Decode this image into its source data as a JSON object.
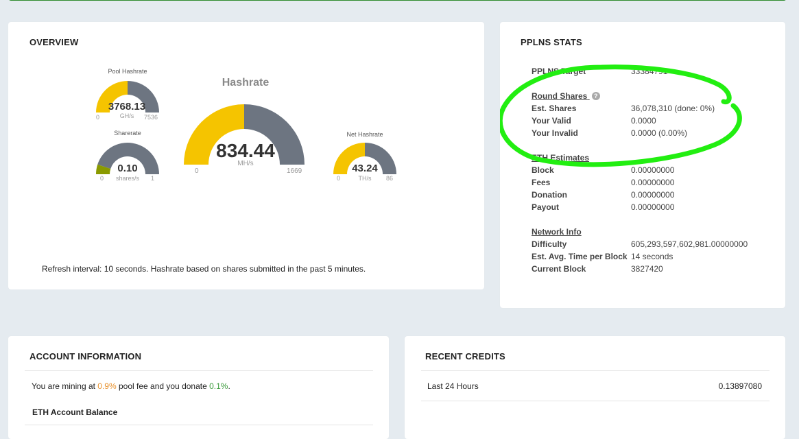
{
  "overview": {
    "title": "OVERVIEW",
    "gauges": {
      "pool": {
        "title": "Pool Hashrate",
        "value": "3768.13",
        "unit": "GH/s",
        "min": "0",
        "max": "7536",
        "fraction": 0.5
      },
      "share": {
        "title": "Sharerate",
        "value": "0.10",
        "unit": "shares/s",
        "min": "0",
        "max": "1",
        "fraction": 0.1
      },
      "main": {
        "title": "Hashrate",
        "value": "834.44",
        "unit": "MH/s",
        "min": "0",
        "max": "1669",
        "fraction": 0.5
      },
      "net": {
        "title": "Net Hashrate",
        "value": "43.24",
        "unit": "TH/s",
        "min": "0",
        "max": "86",
        "fraction": 0.5
      }
    },
    "footnote": "Refresh interval: 10 seconds. Hashrate based on shares submitted in the past 5 minutes."
  },
  "pplns": {
    "title": "PPLNS STATS",
    "target": {
      "label": "PPLNS Target",
      "value": "33384791"
    },
    "round_head": "Round Shares",
    "help_icon": "help-icon",
    "round": [
      {
        "label": "Est. Shares",
        "value": "36,078,310 (done: 0%)"
      },
      {
        "label": "Your Valid",
        "value": "0.0000"
      },
      {
        "label": "Your Invalid",
        "value": "0.0000 (0.00%)"
      }
    ],
    "eth_head": "ETH Estimates",
    "eth": [
      {
        "label": "Block",
        "value": "0.00000000"
      },
      {
        "label": "Fees",
        "value": "0.00000000"
      },
      {
        "label": "Donation",
        "value": "0.00000000"
      },
      {
        "label": "Payout",
        "value": "0.00000000"
      }
    ],
    "net_head": "Network Info",
    "net": [
      {
        "label": "Difficulty",
        "value": "605,293,597,602,981.00000000"
      },
      {
        "label": "Est. Avg. Time per Block",
        "value": "14 seconds"
      },
      {
        "label": "Current Block",
        "value": "3827420"
      }
    ]
  },
  "account": {
    "title": "ACCOUNT INFORMATION",
    "text_pre": "You are mining at ",
    "fee": "0.9%",
    "text_mid": " pool fee and you donate ",
    "donate": "0.1%",
    "text_post": ".",
    "balance_label": "ETH Account Balance"
  },
  "credits": {
    "title": "RECENT CREDITS",
    "label": "Last 24 Hours",
    "value": "0.13897080"
  },
  "colors": {
    "gauge_fill": "#f5c400",
    "gauge_empty": "#6d7581",
    "sharerate_fill": "#8a9a00",
    "annotation_green": "#22ee11",
    "fee_orange": "#e8902a",
    "donate_green": "#3a9a3a"
  }
}
